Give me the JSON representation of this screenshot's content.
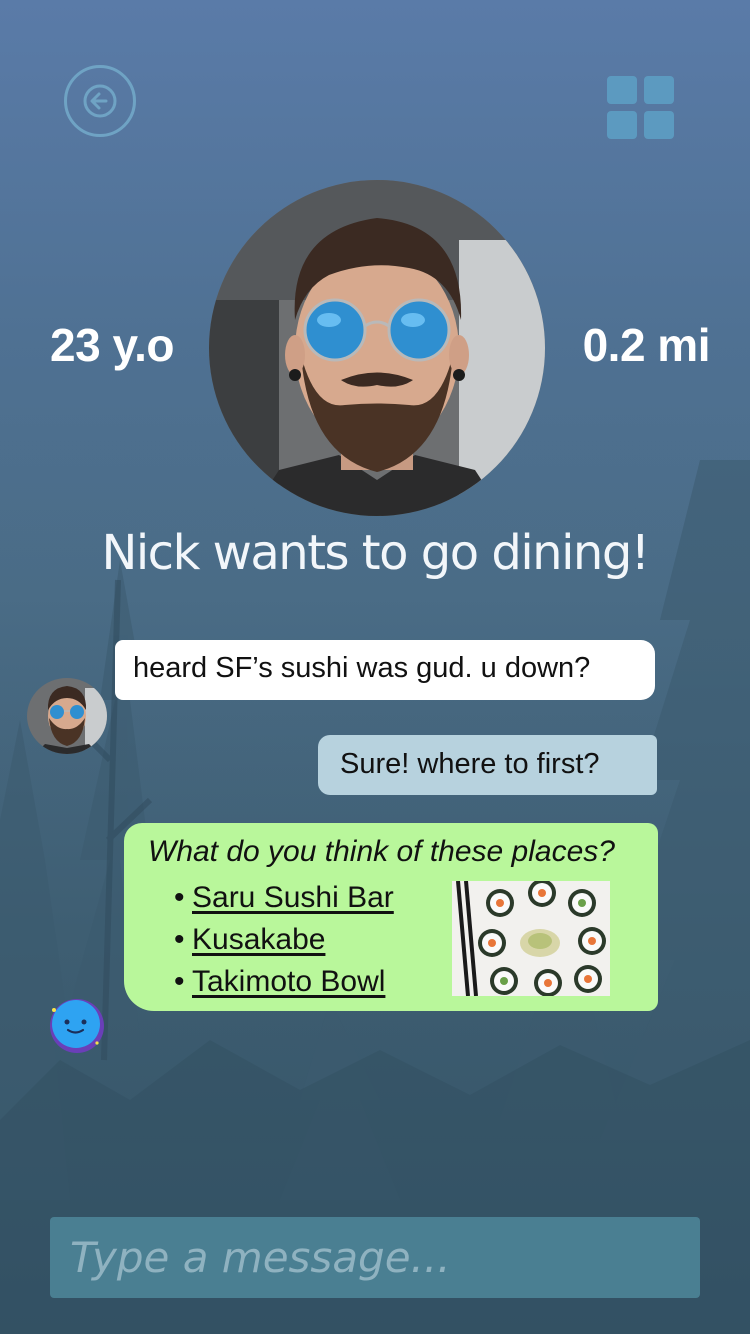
{
  "header": {
    "back_icon": "arrow-left-icon",
    "menu_icon": "grid-icon"
  },
  "profile": {
    "age": "23 y.o",
    "distance": "0.2 mi",
    "headline": "Nick wants to go dining!"
  },
  "chat": {
    "messages": [
      {
        "from": "Nick",
        "text": "heard SF’s sushi was gud. u down?"
      },
      {
        "from": "me",
        "text": "Sure! where to first?"
      }
    ],
    "suggestion_card": {
      "title": "What do you think of these places?",
      "places": [
        "Saru Sushi Bar",
        "Kusakabe",
        "Takimoto Bowl"
      ],
      "image_icon": "sushi-photo"
    },
    "bot_icon": "smiley-bot-icon"
  },
  "composer": {
    "placeholder": "Type a message...",
    "value": ""
  },
  "colors": {
    "accent": "#5c9ac0",
    "incoming_bubble": "#ffffff",
    "outgoing_bubble": "#b7d2de",
    "card_bubble": "#b9f79b",
    "input_bg": "#4a7f92"
  }
}
